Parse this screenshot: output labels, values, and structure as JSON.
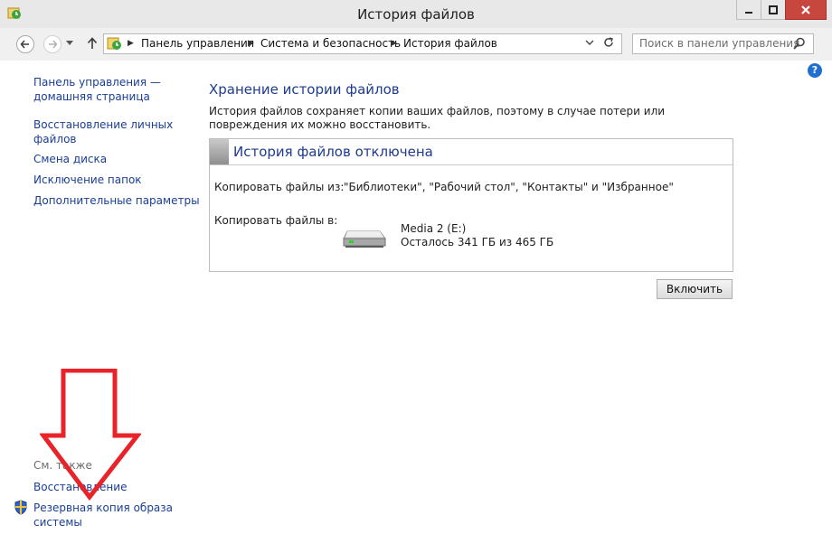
{
  "window": {
    "title": "История файлов"
  },
  "address": {
    "crumbs": [
      "Панель управления",
      "Система и безопасность",
      "История файлов"
    ],
    "search_placeholder": "Поиск в панели управления"
  },
  "sidebar": {
    "home": "Панель управления — домашняя страница",
    "restore": "Восстановление личных файлов",
    "drive": "Смена диска",
    "exclude": "Исключение папок",
    "advanced": "Дополнительные параметры"
  },
  "see_also": {
    "label": "См. также",
    "restore": "Восстановление",
    "backup": "Резервная копия образа системы"
  },
  "main": {
    "heading": "Хранение истории файлов",
    "description": "История файлов сохраняет копии ваших файлов, поэтому в случае потери или повреждения их можно восстановить.",
    "status_title": "История файлов отключена",
    "copy_from_label": "Копировать файлы из:",
    "copy_from_value": "\"Библиотеки\", \"Рабочий стол\", \"Контакты\" и \"Избранное\"",
    "copy_to_label": "Копировать файлы в:",
    "drive_name": "Media 2 (E:)",
    "drive_space": "Осталось 341 ГБ из 465 ГБ",
    "enable_button": "Включить"
  },
  "help": {
    "glyph": "?"
  },
  "colors": {
    "link": "#1a3e96",
    "heading": "#1e3b8f",
    "close_button": "#c7463e",
    "annotation_arrow": "#e8232a"
  }
}
